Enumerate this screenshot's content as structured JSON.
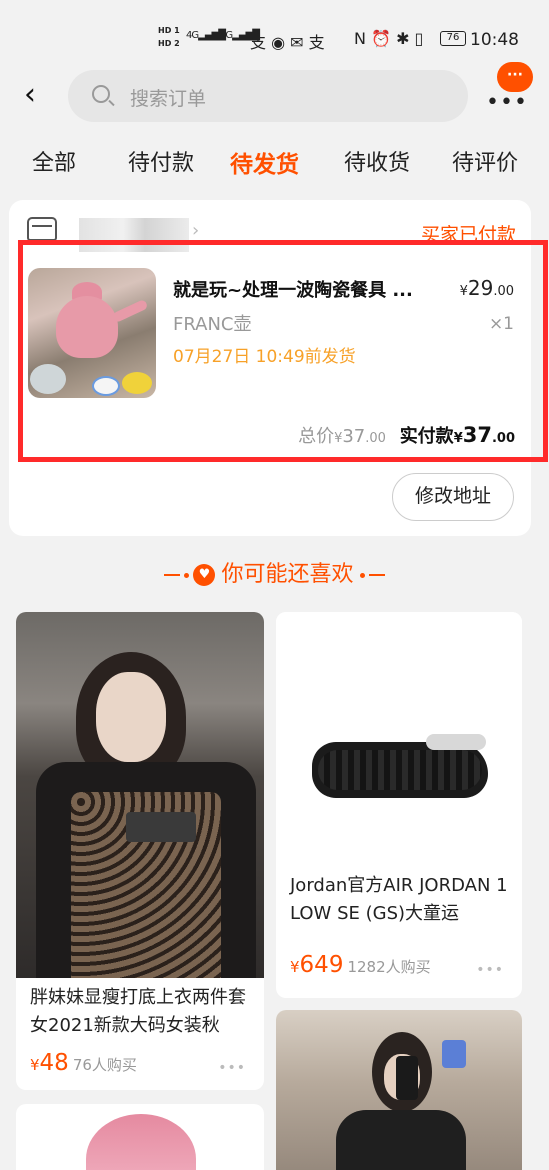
{
  "statusbar": {
    "hd1": "HD 1",
    "hd2": "HD 2",
    "net1": "4G",
    "net2": "4G",
    "app_icons": "支 ◉ ✉ 支",
    "sys_icons": "N ⏰ ✱ ▯",
    "battery": "76",
    "time": "10:48"
  },
  "nav": {
    "back_glyph": "‹",
    "search_placeholder": "搜索订单",
    "more_glyph": "•••",
    "more_badge": "···"
  },
  "tabs": [
    {
      "label": "全部"
    },
    {
      "label": "待付款"
    },
    {
      "label": "待发货"
    },
    {
      "label": "待收货"
    },
    {
      "label": "待评价"
    }
  ],
  "order": {
    "status": "买家已付款",
    "product_title": "就是玩~处理一波陶瓷餐具 ...",
    "price_int": "29",
    "price_dec": ".00",
    "currency": "¥",
    "sku": "FRANC壶",
    "qty": "×1",
    "ship_note": "07月27日 10:49前发货",
    "total_label": "总价",
    "total_int": "37",
    "total_dec": ".00",
    "paid_label": "实付款",
    "paid_int": "37",
    "paid_dec": ".00",
    "modify_address": "修改地址"
  },
  "recommend": {
    "title": "你可能还喜欢",
    "items": [
      {
        "name": "胖妹妹显瘦打底上衣两件套女2021新款大码女装秋",
        "price": "48",
        "sold": "76人购买"
      },
      {
        "name": "Jordan官方AIR JORDAN 1 LOW SE (GS)大童运",
        "price": "649",
        "sold": "1282人购买"
      }
    ],
    "more_glyph": "•••",
    "currency": "¥"
  }
}
